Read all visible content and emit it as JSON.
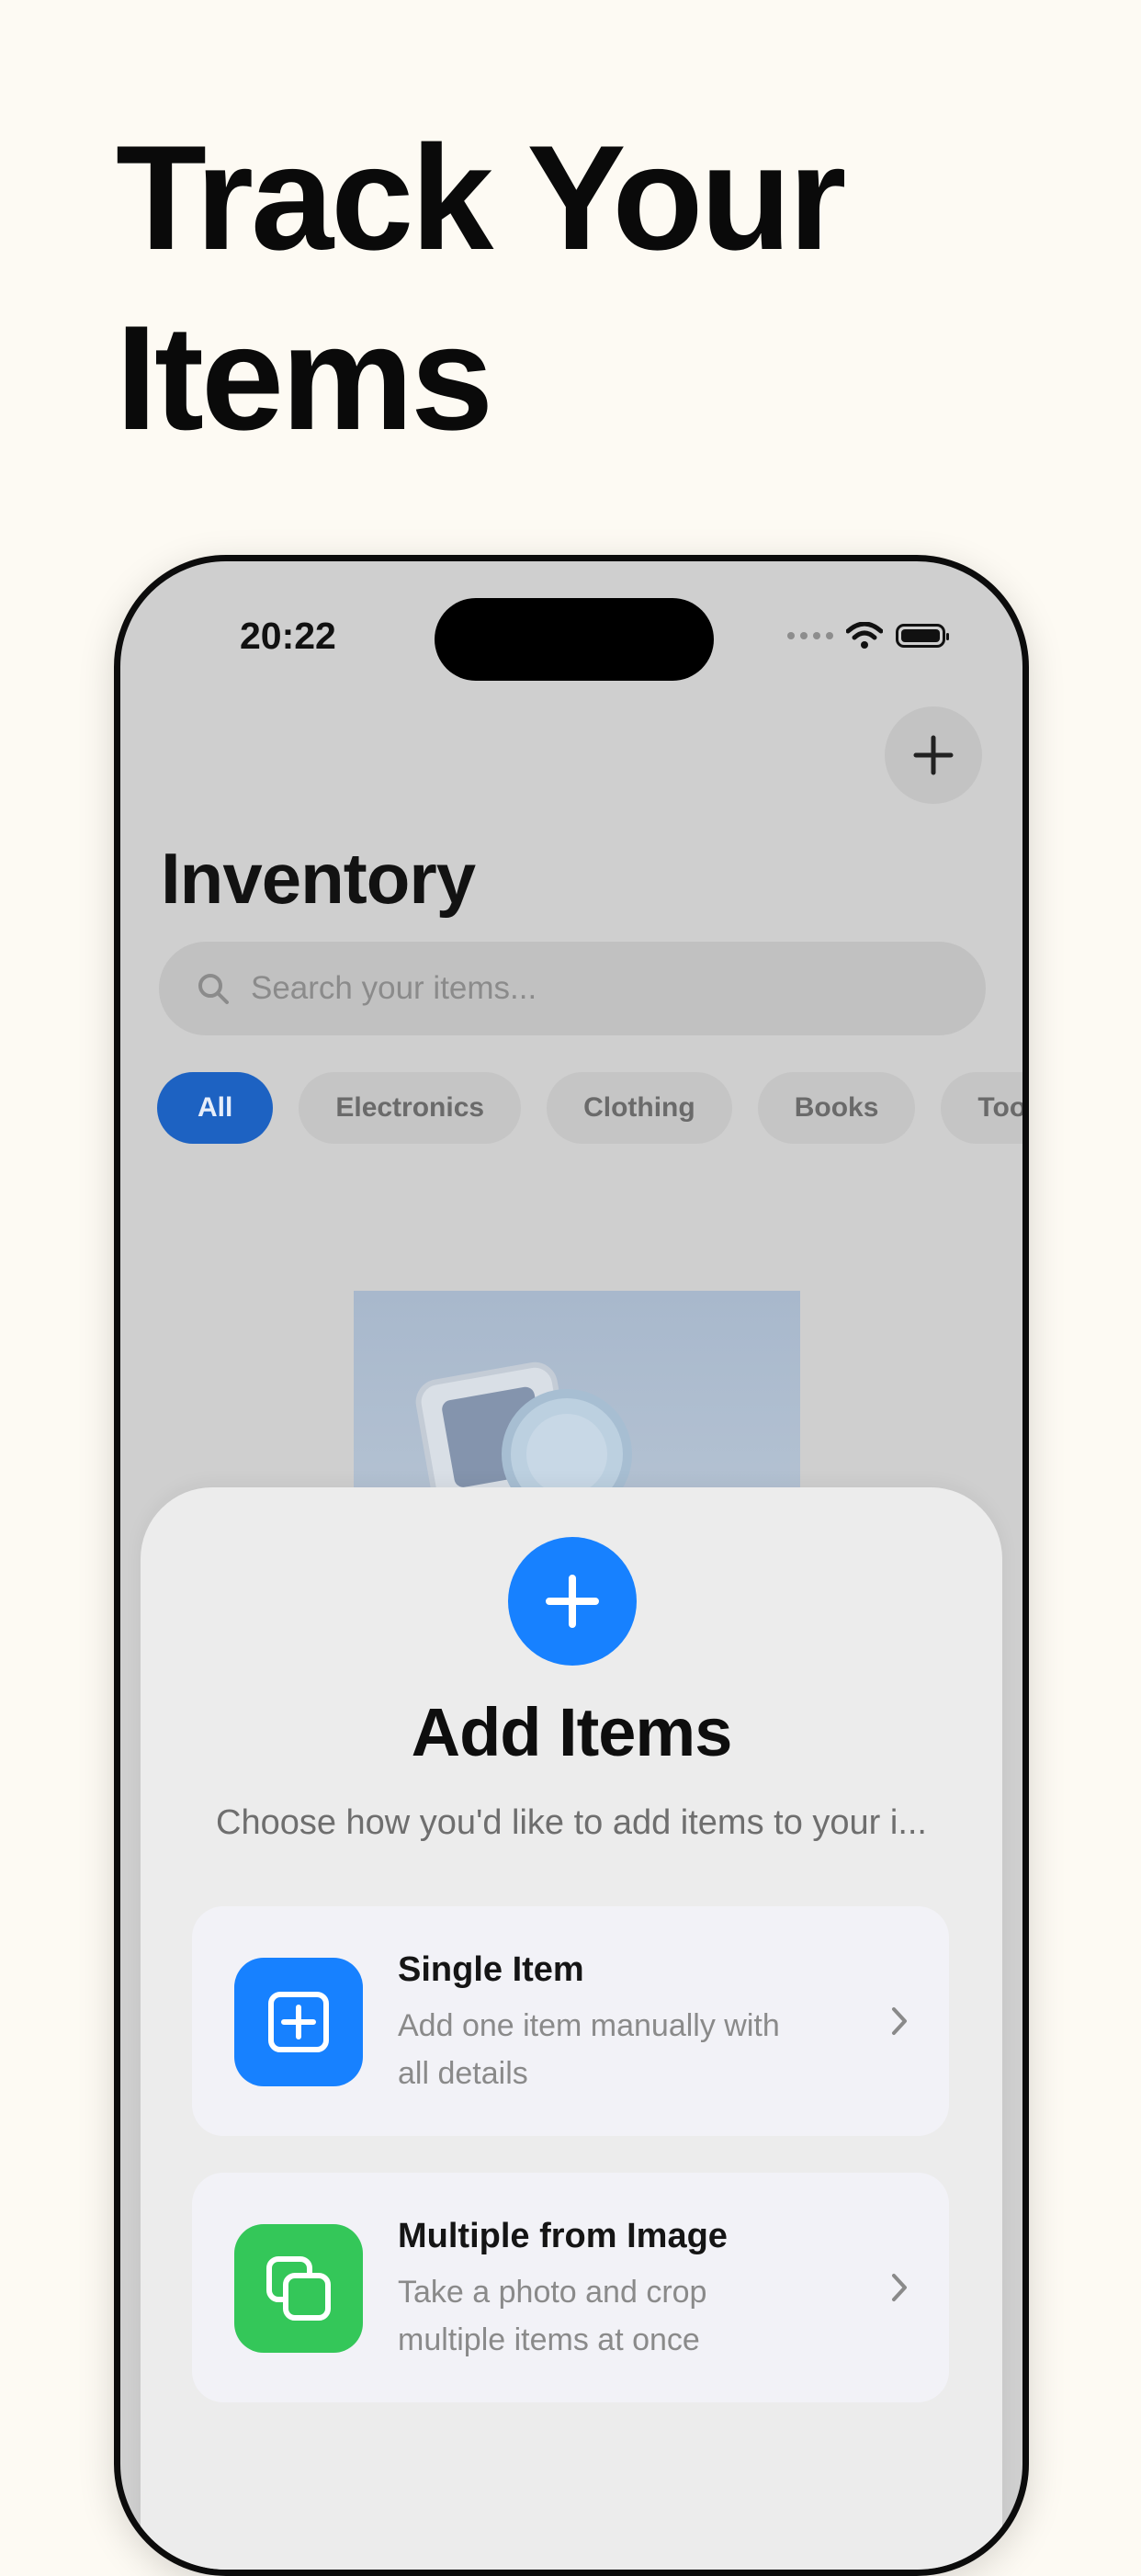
{
  "headline": {
    "line1": "Track Your",
    "line2": "Items"
  },
  "status_bar": {
    "time": "20:22"
  },
  "inventory": {
    "title": "Inventory",
    "search_placeholder": "Search your items...",
    "categories": [
      "All",
      "Electronics",
      "Clothing",
      "Books",
      "Too"
    ]
  },
  "sheet": {
    "title": "Add Items",
    "subtitle": "Choose how you'd like to add items to your i...",
    "options": [
      {
        "title": "Single Item",
        "desc_line1": "Add one item manually with",
        "desc_line2": "all details",
        "icon": "plus-square-icon",
        "color": "#1781ff"
      },
      {
        "title": "Multiple from Image",
        "desc_line1": "Take a photo and crop",
        "desc_line2": "multiple items at once",
        "icon": "stacked-squares-icon",
        "color": "#34c759"
      }
    ]
  },
  "colors": {
    "accent_blue": "#1781ff",
    "accent_green": "#34c759",
    "chip_active": "#1d62c2",
    "background": "#fdfaf3"
  }
}
